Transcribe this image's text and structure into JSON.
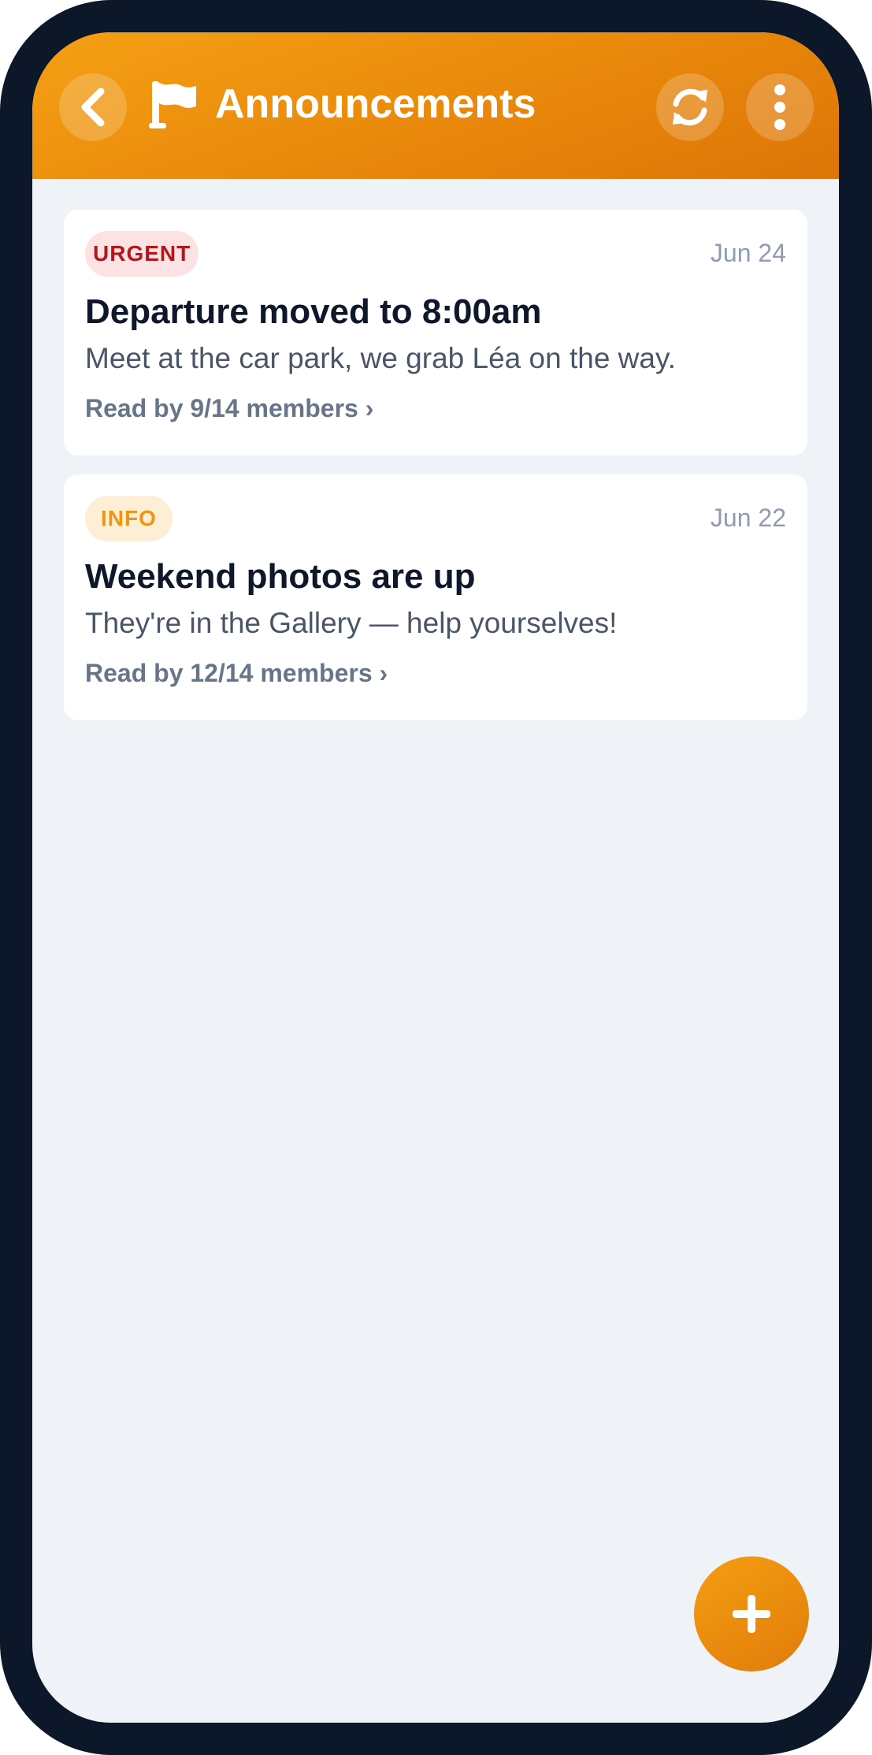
{
  "header": {
    "title": "Announcements",
    "back_icon": "chevron-left-icon",
    "title_icon": "flag-icon",
    "refresh_icon": "refresh-icon",
    "more_icon": "more-vertical-icon"
  },
  "announcements": [
    {
      "badge": "URGENT",
      "date": "Jun 24",
      "title": "Departure moved to 8:00am",
      "body": "Meet at the car park, we grab Léa on the way.",
      "read_by": "Read by 9/14 members ›"
    },
    {
      "badge": "INFO",
      "date": "Jun 22",
      "title": "Weekend photos are up",
      "body": "They're in the Gallery — help yourselves!",
      "read_by": "Read by 12/14 members ›"
    }
  ],
  "fab": {
    "icon": "plus-icon"
  },
  "colors": {
    "accent": "#ee900d",
    "urgent": "#b3161c",
    "urgent_bg": "#fde2e4",
    "info": "#ec9612",
    "info_bg": "#fdeed5"
  }
}
